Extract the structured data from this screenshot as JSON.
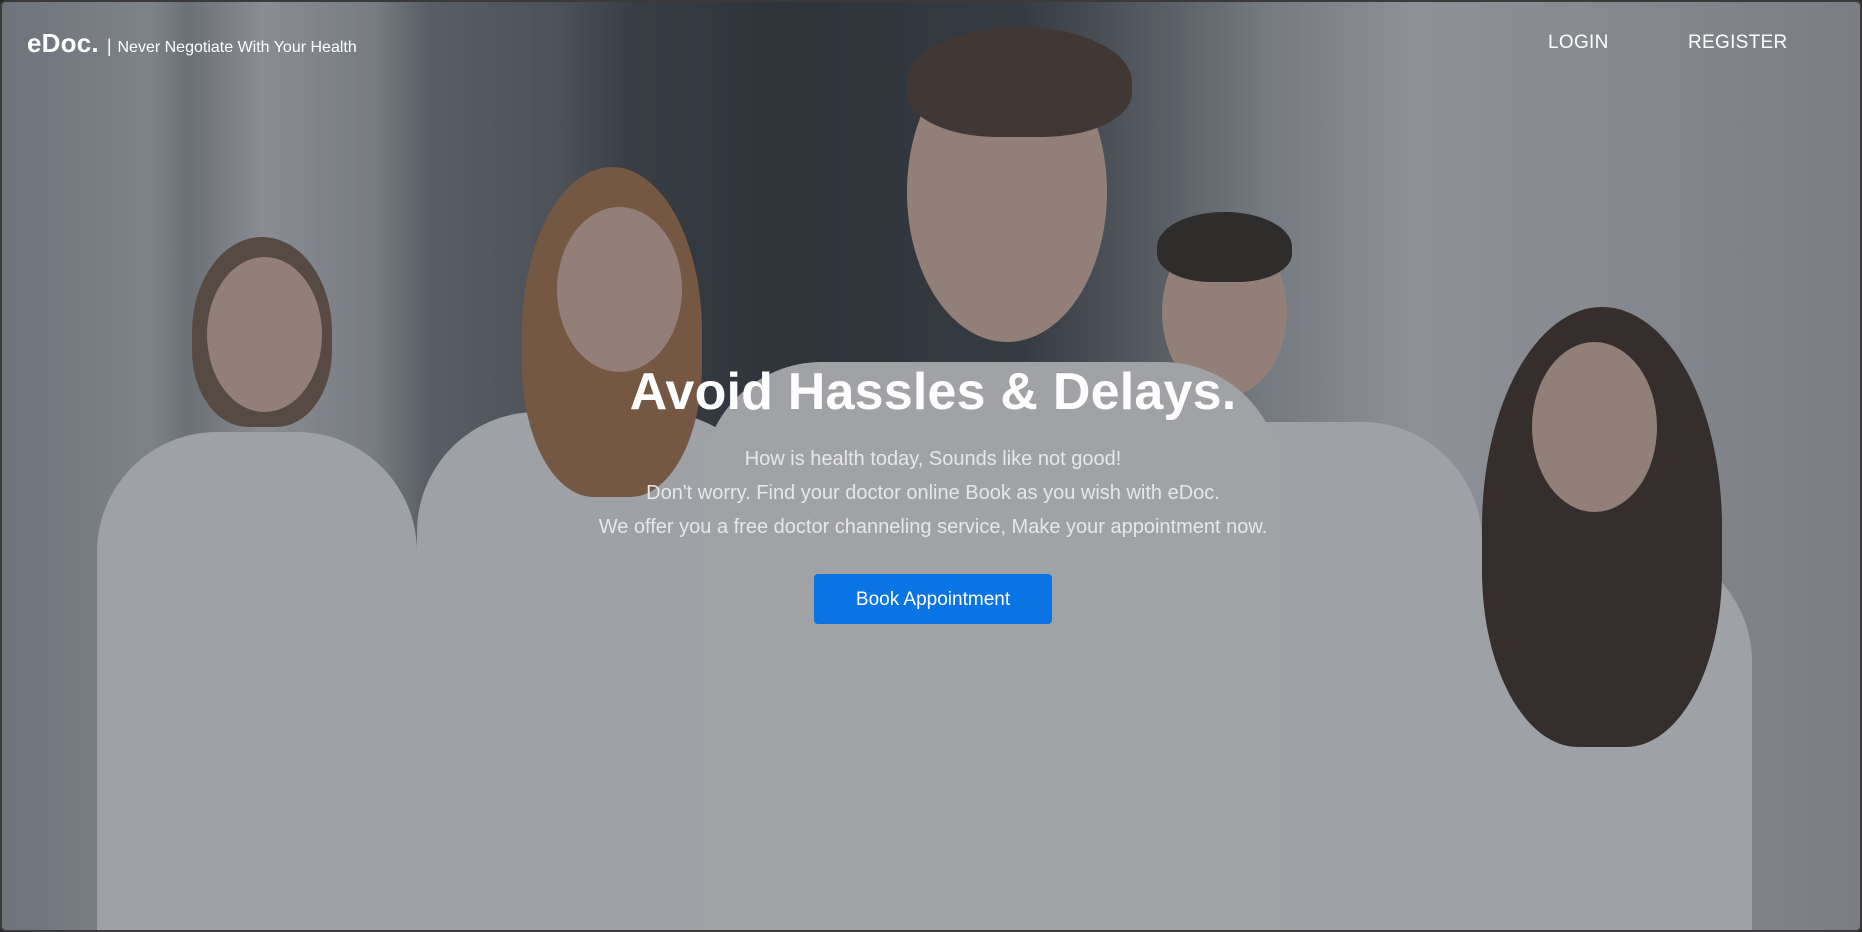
{
  "brand": {
    "name": "eDoc.",
    "separator": "|",
    "tagline": "Never Negotiate With Your Health"
  },
  "nav": {
    "login_label": "LOGIN",
    "register_label": "REGISTER"
  },
  "hero": {
    "title": "Avoid Hassles & Delays.",
    "lines": [
      "How is health today, Sounds like not good!",
      "Don't worry. Find your doctor online Book as you wish with eDoc.",
      "We offer you a free doctor channeling service, Make your appointment now."
    ],
    "button_label": "Book Appointment"
  },
  "colors": {
    "accent": "#0b74e5",
    "text": "#ffffff"
  }
}
